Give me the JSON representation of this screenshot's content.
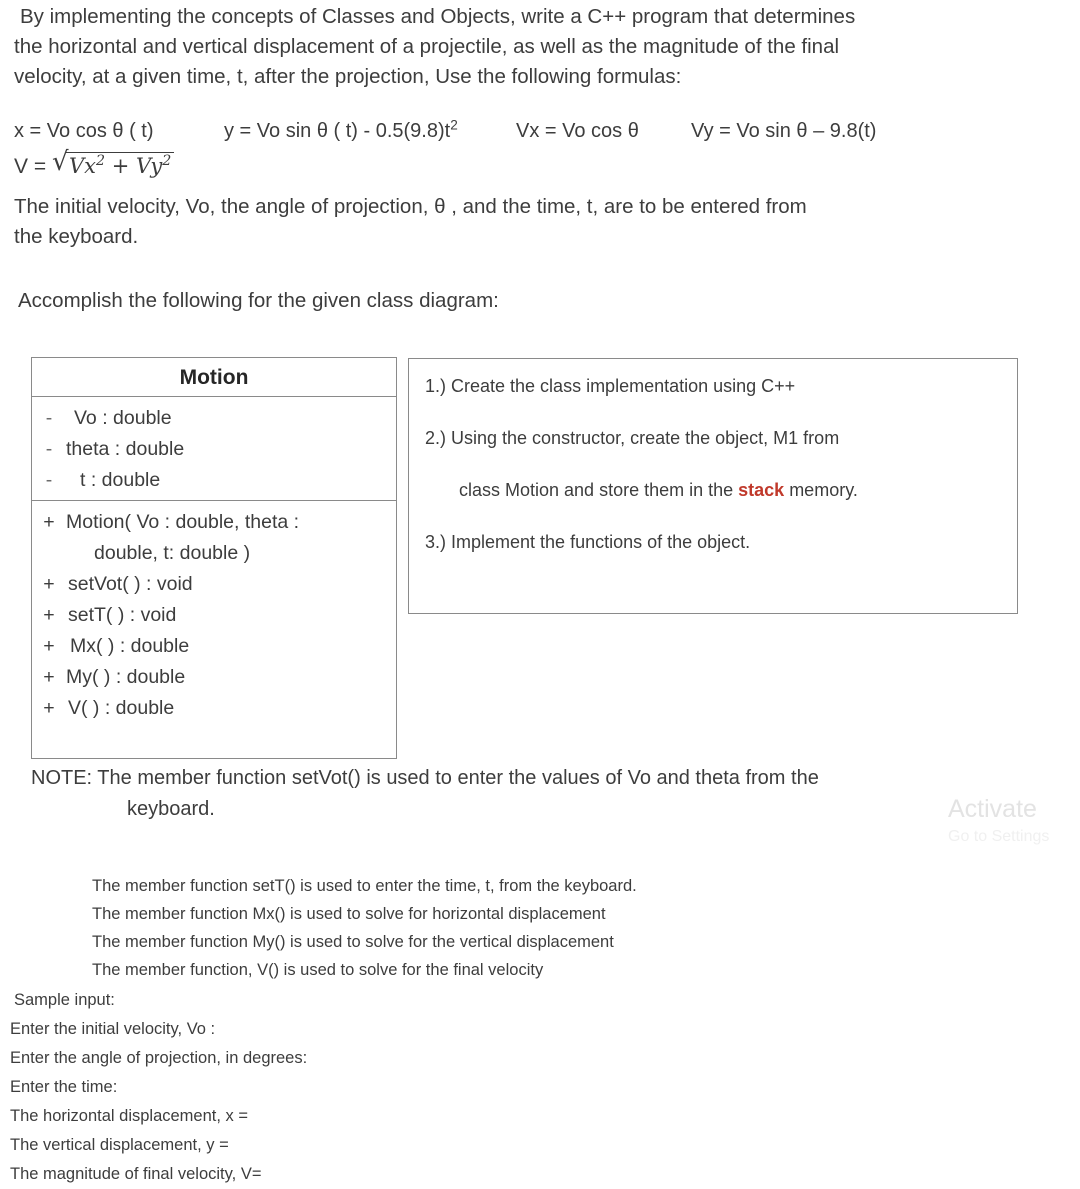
{
  "intro": {
    "line1": "By implementing the concepts of Classes and Objects, write a C++ program that determines",
    "line2": "the horizontal and vertical displacement of a projectile, as well as the magnitude of the final",
    "line3": "velocity, at a given time, t, after the projection, Use the following formulas:"
  },
  "formulas": {
    "x": "x = Vo cos θ ( t)",
    "y_pre": "y = Vo sin θ ( t)  - 0.5(9.8)t",
    "y_sup": "2",
    "vx": "Vx = Vo cos θ",
    "vy": "Vy = Vo sin θ – 9.8(t)",
    "v_lhs": "V =",
    "v_radical_sign": "√",
    "v_radicand_a": "Vx",
    "v_radicand_a_sup": "2",
    "v_radicand_plus": " + ",
    "v_radicand_b": "Vy",
    "v_radicand_b_sup": "2"
  },
  "para2": {
    "line1": "The initial velocity, Vo, the angle of projection,  θ , and the time, t,  are to be entered from",
    "line2": "the keyboard."
  },
  "para3": {
    "text": "Accomplish the following for the given class diagram:"
  },
  "class_diagram": {
    "title": "Motion",
    "attributes": [
      {
        "visibility": "-",
        "text": "Vo : double"
      },
      {
        "visibility": "-",
        "text": "theta : double"
      },
      {
        "visibility": "-",
        "text": "t :  double"
      }
    ],
    "operations": [
      {
        "visibility": "+",
        "text": "Motion( Vo : double, theta :",
        "cont": "double, t: double )"
      },
      {
        "visibility": "+",
        "text": "setVot( ) :  void"
      },
      {
        "visibility": "+",
        "text": "setT( ) : void"
      },
      {
        "visibility": "+",
        "text": "Mx( ) : double"
      },
      {
        "visibility": "+",
        "text": "My( ) :  double"
      },
      {
        "visibility": "+",
        "text": "V( ) :  double"
      }
    ]
  },
  "tasks": {
    "task1": "1.) Create the class implementation using C++",
    "task2a": "2.) Using the constructor, create the object, M1  from",
    "task2b_pre": "class Motion and store them in the ",
    "task2b_hl": "stack",
    "task2b_post": " memory.",
    "task3": "3.) Implement the functions of the  object."
  },
  "note": {
    "line1": "NOTE: The member function setVot() is used to enter the values of Vo and theta from the",
    "line2": "keyboard."
  },
  "watermark": {
    "line1": "Activate",
    "line2": "Go to Settings"
  },
  "function_descriptions": [
    "The member function setT() is used to enter the time, t, from the keyboard.",
    "The member function Mx() is used to solve for horizontal displacement",
    "The member function My() is used to solve for the vertical displacement",
    "The member function, V() is used to solve for the final velocity"
  ],
  "sample_io": {
    "heading": "Sample input:",
    "lines": [
      "Enter the initial velocity, Vo :",
      "Enter the angle of projection, in degrees:",
      "Enter the time:",
      "The horizontal displacement, x =",
      "The vertical displacement, y =",
      "The magnitude of final velocity, V="
    ]
  }
}
